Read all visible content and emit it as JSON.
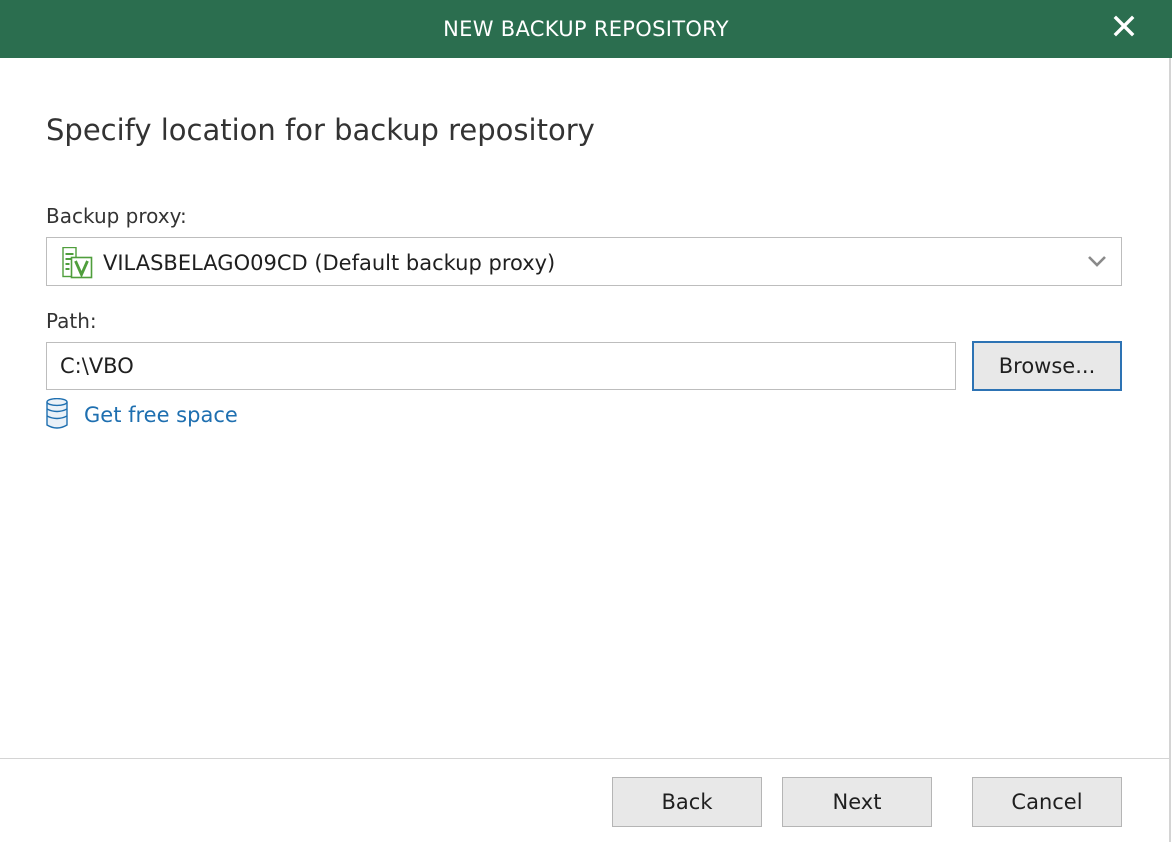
{
  "window": {
    "title": "NEW BACKUP REPOSITORY",
    "accent_color": "#2b6e4f"
  },
  "page": {
    "heading": "Specify location for backup repository"
  },
  "proxy": {
    "label": "Backup proxy:",
    "selected_value": "VILASBELAGO09CD (Default backup proxy)",
    "icon": "veeam-proxy-server-icon"
  },
  "path": {
    "label": "Path:",
    "value": "C:\\VBO",
    "browse_label": "Browse..."
  },
  "free_space": {
    "link_label": "Get free space",
    "icon": "database-icon"
  },
  "footer": {
    "back_label": "Back",
    "next_label": "Next",
    "cancel_label": "Cancel"
  }
}
